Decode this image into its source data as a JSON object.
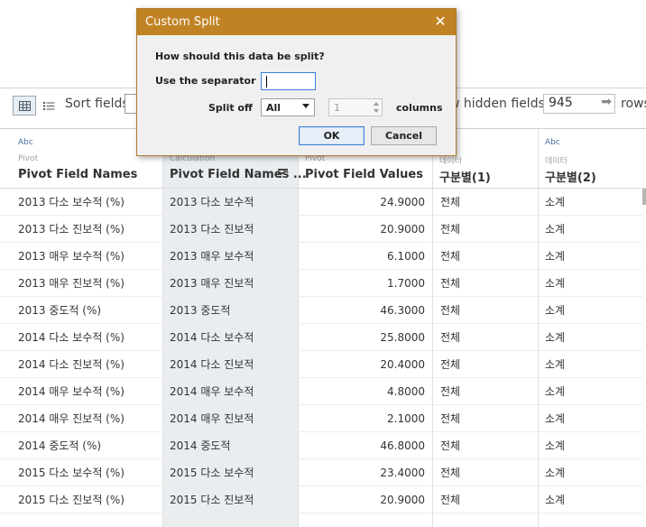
{
  "dialog": {
    "title": "Custom Split",
    "question": "How should this data be split?",
    "separator_label": "Use the separator",
    "separator_value": "",
    "split_off_label": "Split off",
    "split_off_value": "All",
    "count_value": "1",
    "columns_label": "columns",
    "ok_label": "OK",
    "cancel_label": "Cancel"
  },
  "toolbar": {
    "sort_label": "Sort fields",
    "hidden_fields_label": "w hidden fields",
    "rows_value": "945",
    "rows_label": "rows"
  },
  "columns": [
    {
      "type": "Abc",
      "role": "Pivot",
      "name": "Pivot Field Names"
    },
    {
      "type": "",
      "role": "Calculation",
      "name": "Pivot Field Names ..."
    },
    {
      "type": "",
      "role": "Pivot",
      "name": "Pivot Field Values"
    },
    {
      "type": "",
      "role": "데이터",
      "name": "구분별(1)"
    },
    {
      "type": "Abc",
      "role": "데이터",
      "name": "구분별(2)"
    }
  ],
  "rows": [
    [
      "2013 다소 보수적 (%)",
      "2013 다소 보수적",
      "24.9000",
      "전체",
      "소계"
    ],
    [
      "2013 다소 진보적 (%)",
      "2013 다소 진보적",
      "20.9000",
      "전체",
      "소계"
    ],
    [
      "2013 매우 보수적 (%)",
      "2013 매우 보수적",
      "6.1000",
      "전체",
      "소계"
    ],
    [
      "2013 매우 진보적 (%)",
      "2013 매우 진보적",
      "1.7000",
      "전체",
      "소계"
    ],
    [
      "2013 중도적 (%)",
      "2013 중도적",
      "46.3000",
      "전체",
      "소계"
    ],
    [
      "2014 다소 보수적 (%)",
      "2014 다소 보수적",
      "25.8000",
      "전체",
      "소계"
    ],
    [
      "2014 다소 진보적 (%)",
      "2014 다소 진보적",
      "20.4000",
      "전체",
      "소계"
    ],
    [
      "2014 매우 보수적 (%)",
      "2014 매우 보수적",
      "4.8000",
      "전체",
      "소계"
    ],
    [
      "2014 매우 진보적 (%)",
      "2014 매우 진보적",
      "2.1000",
      "전체",
      "소계"
    ],
    [
      "2014 중도적 (%)",
      "2014 중도적",
      "46.8000",
      "전체",
      "소계"
    ],
    [
      "2015 다소 보수적 (%)",
      "2015 다소 보수적",
      "23.4000",
      "전체",
      "소계"
    ],
    [
      "2015 다소 진보적 (%)",
      "2015 다소 진보적",
      "20.9000",
      "전체",
      "소계"
    ]
  ]
}
